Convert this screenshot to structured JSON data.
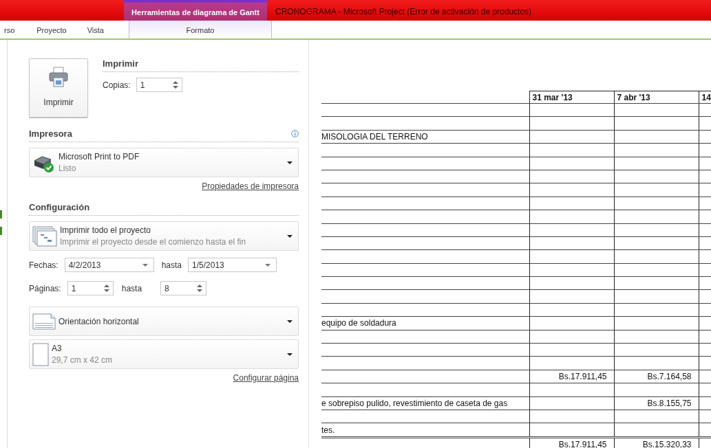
{
  "title_bar": {
    "context_tab": "Herramientas de diagrama de Gantt",
    "title": "CRONOGRAMA  -  Microsoft Project (Error de activación de productos)"
  },
  "ribbon_tabs": [
    {
      "label": "rso",
      "selected": false
    },
    {
      "label": "Proyecto",
      "selected": false
    },
    {
      "label": "Vista",
      "selected": false
    },
    {
      "label": "Formato",
      "selected": false,
      "kind": "context"
    }
  ],
  "print": {
    "button": "Imprimir",
    "heading": "Imprimir",
    "copies_label": "Copias:",
    "copies": "1"
  },
  "printer": {
    "heading": "Impresora",
    "name": "Microsoft Print to PDF",
    "status": "Listo",
    "link": "Propiedades de impresora"
  },
  "configuration": {
    "heading": "Configuración",
    "scope": {
      "title": "Imprimir todo el proyecto",
      "subtitle": "Imprimir el proyecto desde el comienzo hasta el fin"
    },
    "dates": {
      "label": "Fechas:",
      "from": "4/2/2013",
      "to_label": "hasta",
      "to": "1/5/2013"
    },
    "pages": {
      "label": "Páginas:",
      "from": "1",
      "to_label": "hasta",
      "to": "8"
    },
    "options": [
      {
        "kind": "orientation",
        "title": "Orientación horizontal"
      },
      {
        "kind": "paper",
        "title": "A3",
        "subtitle": "29,7 cm x 42 cm"
      }
    ],
    "link": "Configurar página"
  },
  "preview": {
    "columns": [
      "31 mar '13",
      "7 abr '13",
      "14"
    ],
    "rows": [
      {},
      {},
      {
        "task": "MISOLOGIA DEL TERRENO"
      },
      {},
      {},
      {},
      {},
      {},
      {},
      {},
      {},
      {},
      {},
      {},
      {},
      {},
      {
        "task": "equipo de soldadura"
      },
      {},
      {},
      {},
      {
        "week_1": "Bs.17.911,45",
        "week_2": "Bs.7.164,58"
      },
      {},
      {
        "task": "e sobrepiso pulido, revestimiento de caseta de gas",
        "week_2": "Bs.8.155,75"
      },
      {},
      {
        "task": "tes."
      },
      {
        "week_1": "Bs.17.911,45",
        "week_2": "Bs.15.320,33",
        "kind": "total"
      }
    ]
  }
}
